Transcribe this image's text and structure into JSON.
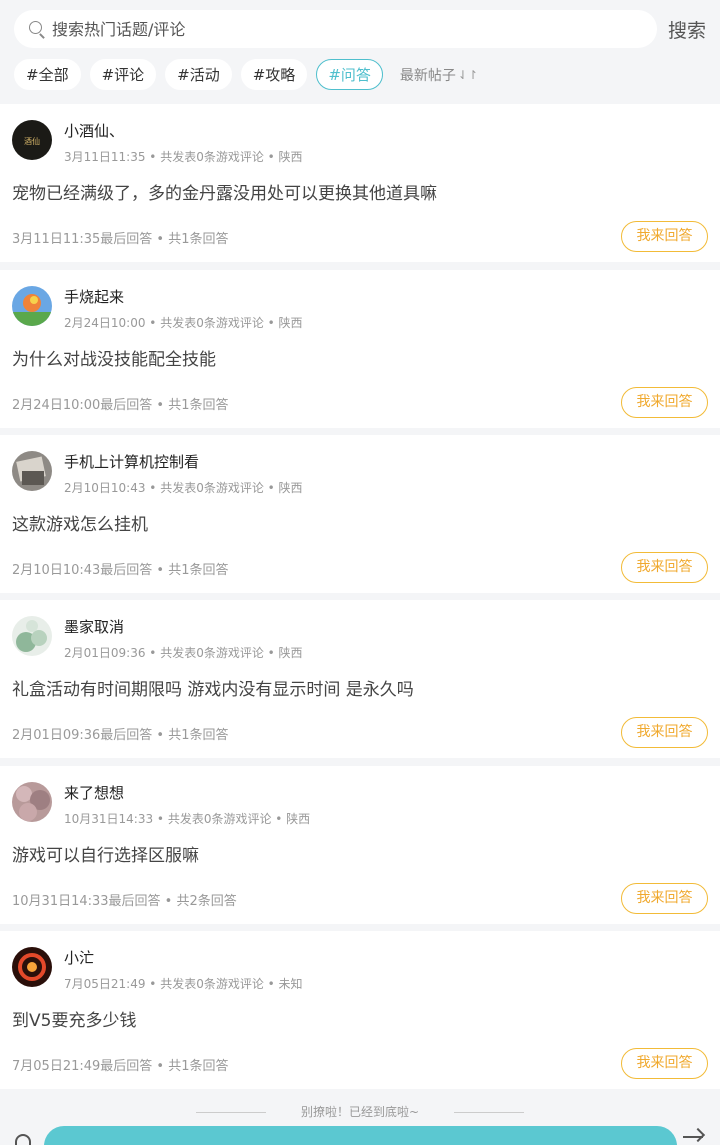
{
  "search": {
    "placeholder": "搜索热门话题/评论",
    "button": "搜索"
  },
  "tags": [
    "#全部",
    "#评论",
    "#活动",
    "#攻略",
    "#问答"
  ],
  "active_tag": "#问答",
  "sort": {
    "label": "最新帖子",
    "icon": "sort-arrows-icon"
  },
  "posts": [
    {
      "user": "小酒仙、",
      "meta": "3月11日11:35 • 共发表0条游戏评论 • 陕西",
      "question": "宠物已经满级了，多的金丹露没用处可以更换其他道具嘛",
      "footer": "3月11日11:35最后回答 • 共1条回答",
      "answer": "我来回答"
    },
    {
      "user": "手烧起来",
      "meta": "2月24日10:00 • 共发表0条游戏评论 • 陕西",
      "question": "为什么对战没技能配全技能",
      "footer": "2月24日10:00最后回答 • 共1条回答",
      "answer": "我来回答"
    },
    {
      "user": "手机上计算机控制看",
      "meta": "2月10日10:43 • 共发表0条游戏评论 • 陕西",
      "question": "这款游戏怎么挂机",
      "footer": "2月10日10:43最后回答 • 共1条回答",
      "answer": "我来回答"
    },
    {
      "user": "墨家取消",
      "meta": "2月01日09:36 • 共发表0条游戏评论 • 陕西",
      "question": "礼盒活动有时间期限吗 游戏内没有显示时间 是永久吗",
      "footer": "2月01日09:36最后回答 • 共1条回答",
      "answer": "我来回答"
    },
    {
      "user": "来了想想",
      "meta": "10月31日14:33 • 共发表0条游戏评论 • 陕西",
      "question": "游戏可以自行选择区服嘛",
      "footer": "10月31日14:33最后回答 • 共2条回答",
      "answer": "我来回答"
    },
    {
      "user": "小汒",
      "meta": "7月05日21:49 • 共发表0条游戏评论 • 未知",
      "question": "到V5要充多少钱",
      "footer": "7月05日21:49最后回答 • 共1条回答",
      "answer": "我来回答"
    }
  ],
  "end_text": "别撩啦！已经到底啦~",
  "colors": {
    "accent": "#4fbfcd",
    "answer": "#f2bb38",
    "bottom_bar": "#5bc8d1"
  }
}
